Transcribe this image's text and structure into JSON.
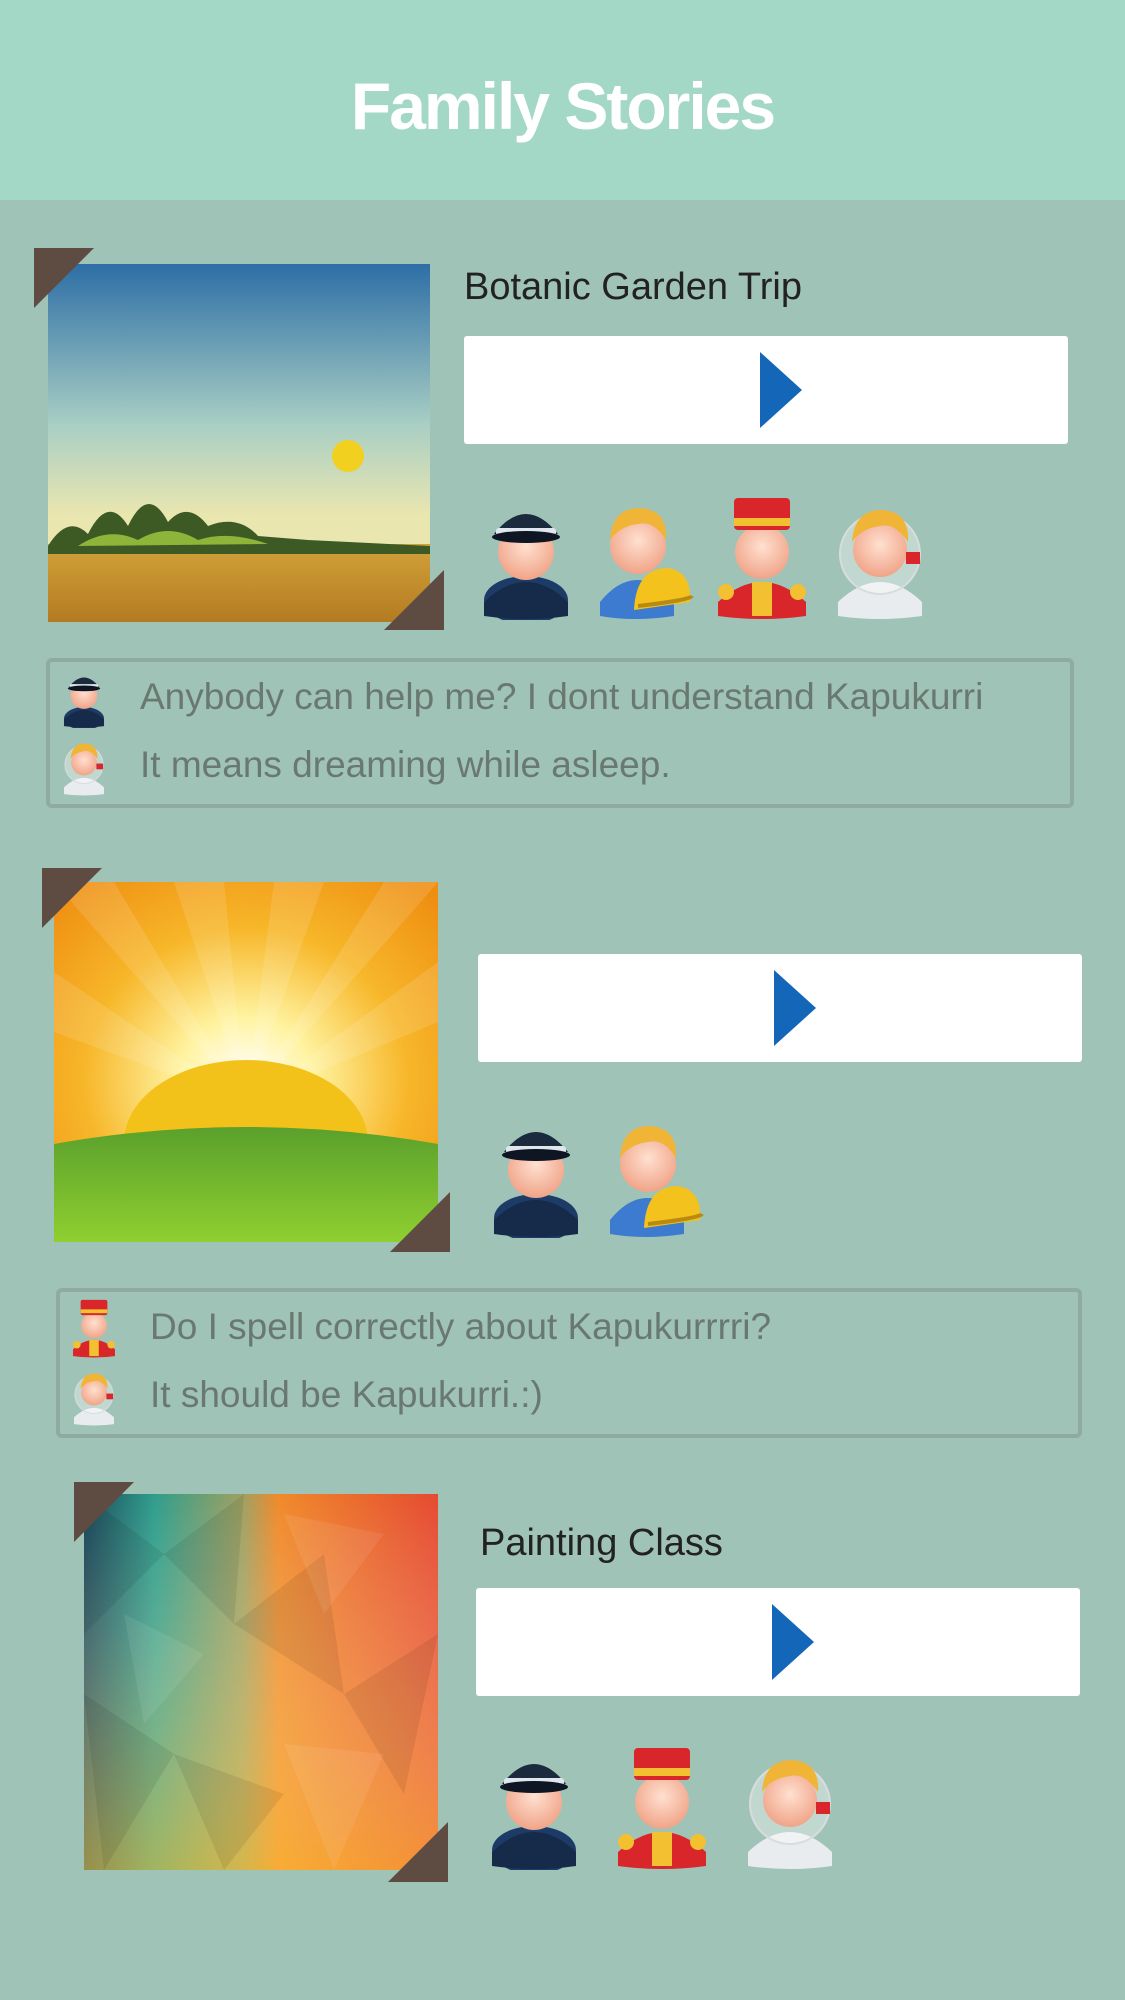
{
  "header": {
    "title": "Family Stories"
  },
  "stories": [
    {
      "title": "Botanic Garden Trip",
      "image": "landscape-sunset-illustration",
      "members": [
        "police-avatar",
        "builder-avatar",
        "bellhop-avatar",
        "nurse-avatar"
      ],
      "messages": [
        {
          "avatar": "police-avatar",
          "text": "Anybody can help me? I dont understand Kapukurri"
        },
        {
          "avatar": "nurse-avatar",
          "text": "It means dreaming while asleep."
        }
      ]
    },
    {
      "title": "",
      "image": "sunrise-over-hill-illustration",
      "members": [
        "police-avatar",
        "builder-avatar"
      ],
      "messages": [
        {
          "avatar": "bellhop-avatar",
          "text": "Do I spell correctly about Kapukurrrri?"
        },
        {
          "avatar": "nurse-avatar",
          "text": "It should be Kapukurri.:)"
        }
      ]
    },
    {
      "title": "Painting Class",
      "image": "low-poly-gradient-art",
      "members": [
        "police-avatar",
        "bellhop-avatar",
        "nurse-avatar"
      ],
      "messages": []
    }
  ],
  "colors": {
    "header_bg": "#a3d7c6",
    "page_bg": "#a0c3b7",
    "play_icon": "#1466b8",
    "corner": "#5e4c42"
  }
}
